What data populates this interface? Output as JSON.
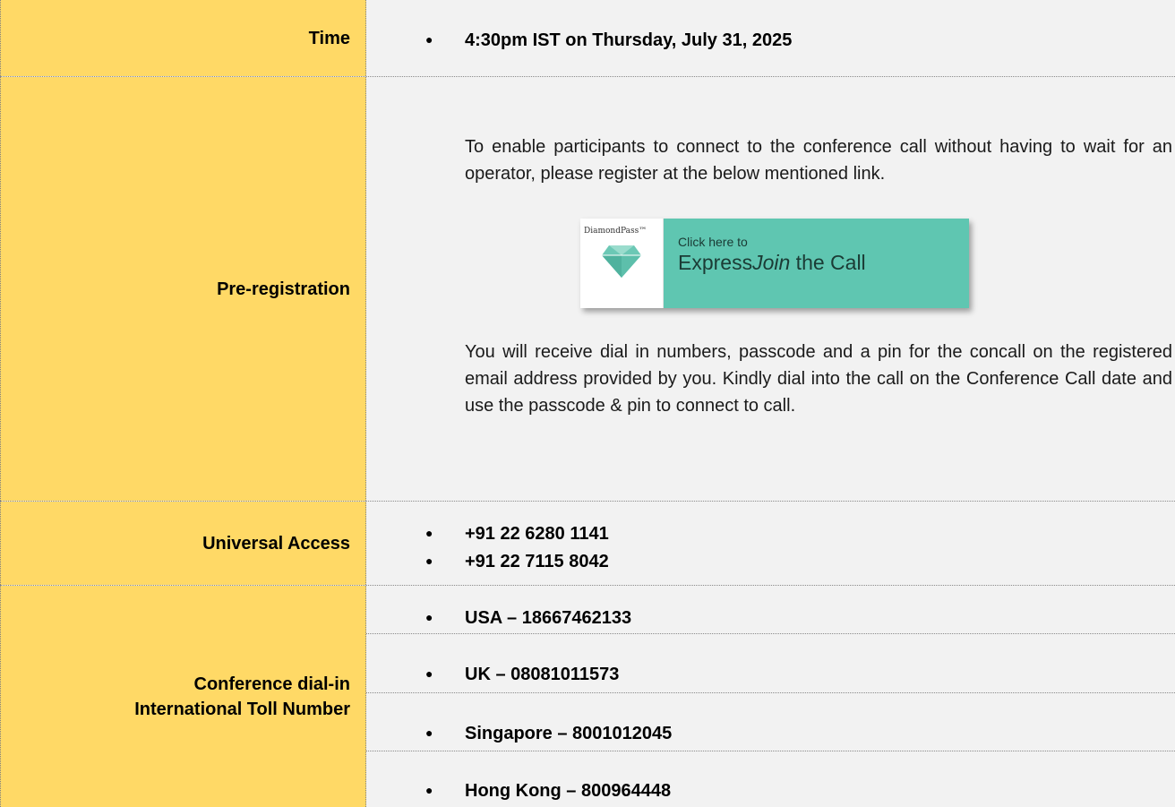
{
  "rows": {
    "time": {
      "label": "Time",
      "value": "4:30pm IST on Thursday, July 31, 2025"
    },
    "preregistration": {
      "label": "Pre-registration",
      "intro": "To enable participants to connect to the conference call without having to wait for an operator, please register at the below mentioned link.",
      "banner": {
        "brand": "DiamondPass™",
        "small_text": "Click here to",
        "big_text_prefix": "Express",
        "big_text_italic": "Join",
        "big_text_suffix": " the Call",
        "gem_icon": "diamond-icon",
        "accent_color": "#5fc6b1"
      },
      "outro": "You will receive dial in numbers, passcode and a pin for the concall on the registered email address provided by you. Kindly dial into the call on the Conference Call date and use the passcode & pin to connect to call."
    },
    "universal_access": {
      "label": "Universal Access",
      "numbers": [
        "+91 22 6280 1141",
        "+91 22 7115 8042"
      ]
    },
    "international": {
      "label_line1": "Conference dial-in",
      "label_line2": "International Toll Number",
      "numbers": [
        "USA – 18667462133",
        "UK – 08081011573",
        "Singapore – 8001012045",
        "Hong Kong – 800964448"
      ]
    }
  },
  "bullet_glyph": "●",
  "colors": {
    "label_bg": "#ffd966",
    "value_bg": "#f2f2f2"
  }
}
